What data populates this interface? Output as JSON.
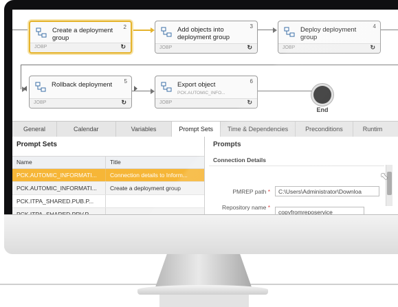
{
  "workflow": {
    "tasks": [
      {
        "name": "Create a deployment group",
        "subtitle": "",
        "number": "2",
        "type": "JOBP",
        "active": true
      },
      {
        "name": "Add objects into deployment group",
        "subtitle": "",
        "number": "3",
        "type": "JOBP",
        "active": false
      },
      {
        "name": "Deploy deployment group",
        "subtitle": "",
        "number": "4",
        "type": "JOBP",
        "active": false
      },
      {
        "name": "Rollback deployment",
        "subtitle": "",
        "number": "5",
        "type": "JOBP",
        "active": false
      },
      {
        "name": "Export object",
        "subtitle": "PCK.AUTOMIC_INFO...",
        "number": "6",
        "type": "JOBP",
        "active": false
      }
    ],
    "end_label": "End",
    "accent_color": "#e5b32c"
  },
  "tabs": [
    {
      "label": "General",
      "active": false
    },
    {
      "label": "Calendar",
      "active": false
    },
    {
      "label": "Variables",
      "active": false
    },
    {
      "label": "Prompt Sets",
      "active": true
    },
    {
      "label": "Time & Dependencies",
      "active": false
    },
    {
      "label": "Preconditions",
      "active": false
    },
    {
      "label": "Runtim",
      "active": false
    }
  ],
  "prompt_sets": {
    "title": "Prompt Sets",
    "columns": [
      "Name",
      "Title"
    ],
    "rows": [
      {
        "name": "PCK.AUTOMIC_INFORMATI...",
        "title": "Connection details to Inform...",
        "selected": true
      },
      {
        "name": "PCK.AUTOMIC_INFORMATI...",
        "title": "Create a deployment group",
        "selected": false
      },
      {
        "name": "PCK.ITPA_SHARED.PUB.P...",
        "title": "",
        "selected": false
      },
      {
        "name": "PCK.ITPA_SHARED.PRV.P...",
        "title": "",
        "selected": false
      }
    ]
  },
  "prompts": {
    "title": "Prompts",
    "section": "Connection Details",
    "fields": [
      {
        "label": "PMREP path",
        "required": "*",
        "value": "C:\\Users\\Administrator\\Downloa"
      },
      {
        "label": "Repository name",
        "required": "*",
        "value": "copyfromreposervice"
      }
    ]
  },
  "icons": {
    "task": "workflow-task-icon",
    "run_state": "refresh-icon",
    "end": "end-node-icon",
    "cursor": "mouse-pointer-icon"
  }
}
